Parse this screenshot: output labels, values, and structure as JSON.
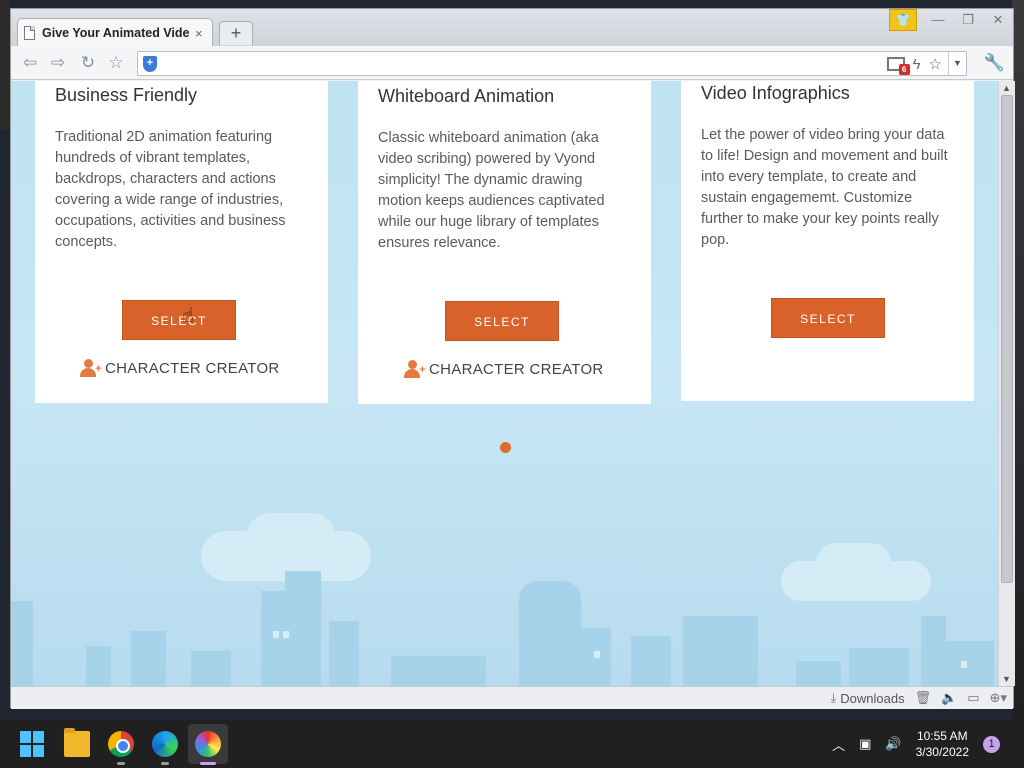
{
  "browser": {
    "tab_title": "Give Your Animated Vide",
    "tab_close": "×",
    "new_tab": "+",
    "status": {
      "downloads_label": "Downloads"
    }
  },
  "page": {
    "cards": [
      {
        "title": "Business Friendly",
        "description": "Traditional 2D animation featuring hundreds of vibrant templates, backdrops, characters and actions covering a wide range of industries, occupations, activities and business concepts.",
        "button": "SELECT",
        "creator_label": "CHARACTER CREATOR"
      },
      {
        "title": "Whiteboard Animation",
        "description": "Classic whiteboard animation (aka video scribing) powered by Vyond simplicity! The dynamic drawing motion keeps audiences captivated while our huge library of templates ensures relevance.",
        "button": "SELECT",
        "creator_label": "CHARACTER CREATOR"
      },
      {
        "title": "Video Infographics",
        "description": "Let the power of video bring your data to life! Design and movement and built into every template, to create and sustain engagememt. Customize further to make your key points really pop.",
        "button": "SELECT"
      }
    ],
    "colors": {
      "accent": "#d9622b",
      "background": "#c6e6f4"
    }
  },
  "toolbar": {
    "notification_count": "6"
  },
  "taskbar": {
    "time": "10:55 AM",
    "date": "3/30/2022",
    "notification_count": "1"
  }
}
